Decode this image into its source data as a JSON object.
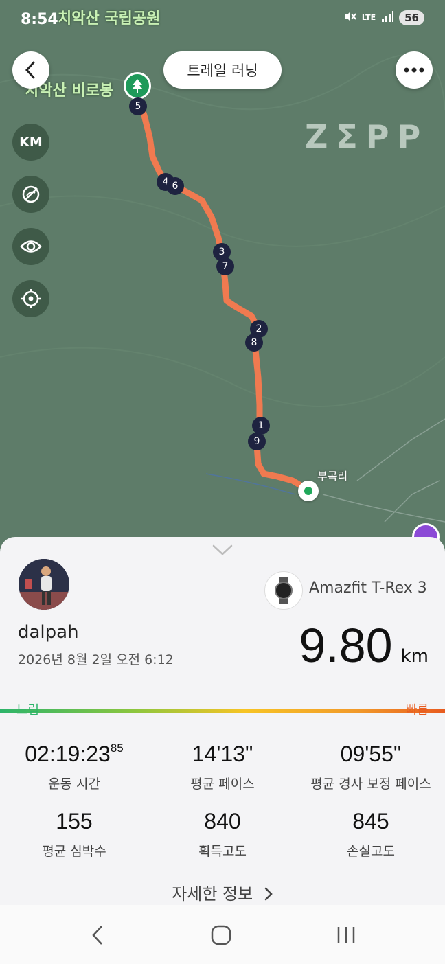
{
  "status": {
    "time": "8:54",
    "network": "LTE",
    "battery": "56"
  },
  "map": {
    "park_name": "치악산 국립공원",
    "peak_label": "치악산 비로봉",
    "village_label": "부곡리",
    "watermark": "ZΣPP",
    "markers": [
      "5",
      "4",
      "6",
      "3",
      "7",
      "2",
      "8",
      "1",
      "9"
    ],
    "route_color": "#f07a50"
  },
  "header": {
    "activity_type": "트레일 러닝"
  },
  "side_controls": {
    "unit_label": "KM"
  },
  "summary": {
    "username": "dalpah",
    "datetime": "2026년 8월 2일 오전 6:12",
    "device": "Amazfit T-Rex 3",
    "distance": "9.80",
    "distance_unit": "km",
    "pace_slow": "느림",
    "pace_fast": "빠름",
    "stats": [
      {
        "value": "02:19:23",
        "suffix": "85",
        "label": "운동 시간"
      },
      {
        "value": "14'13\"",
        "label": "평균 페이스"
      },
      {
        "value": "09'55\"",
        "label": "평균 경사 보정 페이스"
      },
      {
        "value": "155",
        "label": "평균 심박수"
      },
      {
        "value": "840",
        "label": "획득고도"
      },
      {
        "value": "845",
        "label": "손실고도"
      }
    ],
    "more_label": "자세한 정보"
  }
}
